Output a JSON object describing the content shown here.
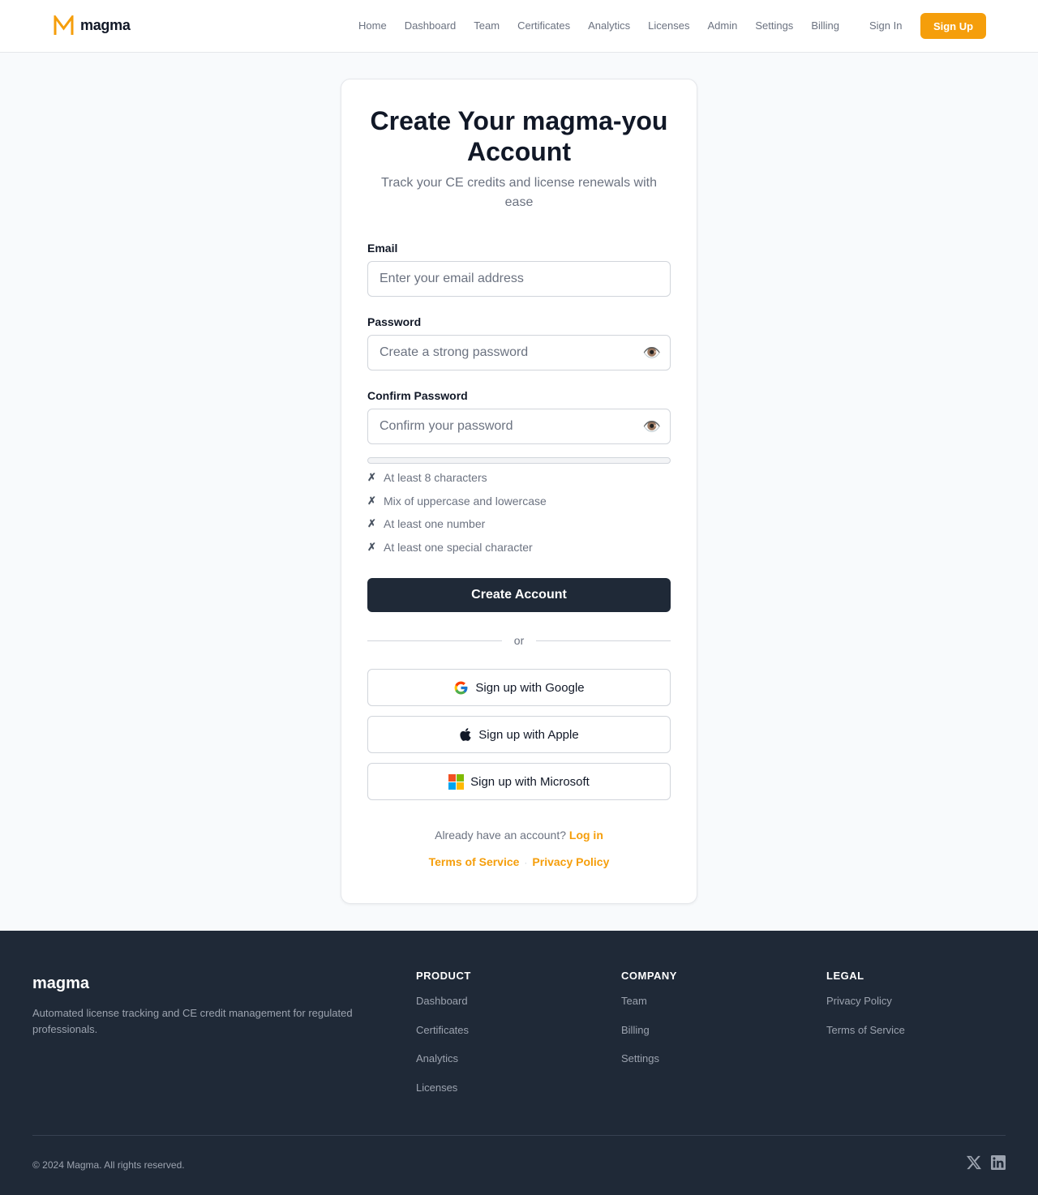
{
  "brand": {
    "name": "magma",
    "accent_color": "#f59e0b",
    "dark_color": "#1f2937"
  },
  "header": {
    "nav": [
      "Home",
      "Dashboard",
      "Team",
      "Certificates",
      "Analytics",
      "Licenses",
      "Admin",
      "Settings",
      "Billing"
    ],
    "signin_label": "Sign In",
    "signup_label": "Sign Up"
  },
  "form": {
    "title": "Create Your magma-you Account",
    "subtitle": "Track your CE credits and license renewals with ease",
    "email": {
      "label": "Email",
      "placeholder": "Enter your email address",
      "value": ""
    },
    "password": {
      "label": "Password",
      "placeholder": "Create a strong password",
      "value": "",
      "toggle_icon": "eye-icon"
    },
    "confirm_password": {
      "label": "Confirm Password",
      "placeholder": "Confirm your password",
      "value": "",
      "toggle_icon": "eye-icon"
    },
    "strength": 0,
    "requirements": [
      {
        "mark": "✗",
        "text": "At least 8 characters"
      },
      {
        "mark": "✗",
        "text": "Mix of uppercase and lowercase"
      },
      {
        "mark": "✗",
        "text": "At least one number"
      },
      {
        "mark": "✗",
        "text": "At least one special character"
      }
    ],
    "submit_label": "Create Account",
    "divider_text": "or",
    "social": {
      "google": "Sign up with Google",
      "apple": "Sign up with Apple",
      "microsoft": "Sign up with Microsoft"
    },
    "already_text": "Already have an account?",
    "login_link": "Log in",
    "terms_link": "Terms of Service",
    "legal_separator": "·",
    "privacy_link": "Privacy Policy"
  },
  "footer": {
    "brand": "magma",
    "description": "Automated license tracking and CE credit management for regulated professionals.",
    "columns": [
      {
        "title": "PRODUCT",
        "links": [
          "Dashboard",
          "Certificates",
          "Analytics",
          "Licenses"
        ]
      },
      {
        "title": "COMPANY",
        "links": [
          "Team",
          "Billing",
          "Settings"
        ]
      },
      {
        "title": "LEGAL",
        "links": [
          "Privacy Policy",
          "Terms of Service"
        ]
      }
    ],
    "copyright": "© 2024 Magma. All rights reserved.",
    "social_icons": [
      "x-icon",
      "linkedin-icon"
    ]
  }
}
